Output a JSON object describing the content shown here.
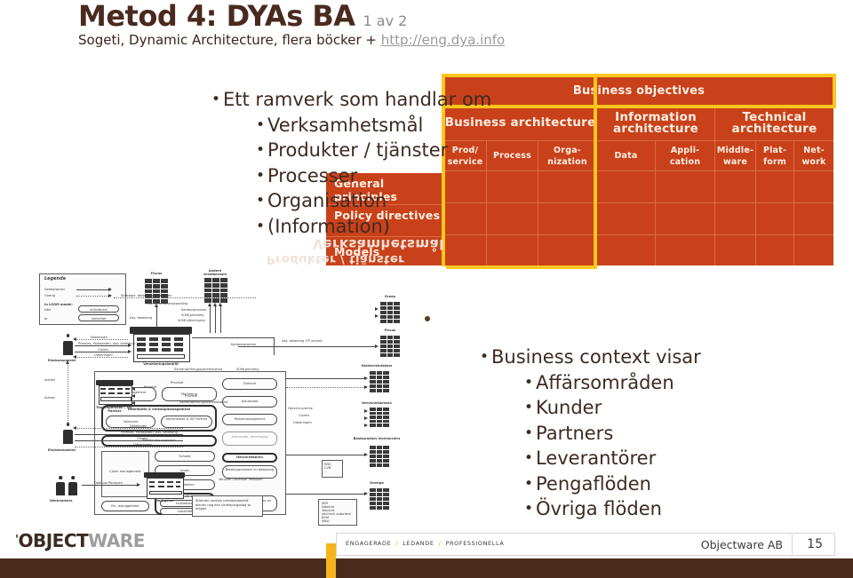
{
  "header": {
    "title_main": "Metod 4: DYAs BA",
    "title_sub": "1 av 2",
    "subtitle_prefix": "Sogeti, Dynamic Architecture, flera böcker + ",
    "subtitle_link": "http://eng.dya.info"
  },
  "bullets_top": {
    "items": [
      {
        "level": 1,
        "text": "Ett ramverk som handlar om"
      },
      {
        "level": 2,
        "text": "Verksamhetsmål"
      },
      {
        "level": 2,
        "text": "Produkter / tjänster"
      },
      {
        "level": 2,
        "text": "Processer"
      },
      {
        "level": 2,
        "text": "Organisation"
      },
      {
        "level": 2,
        "text": "(Information)"
      }
    ],
    "bullet_glyph": "•"
  },
  "bullets_bottom": {
    "items": [
      {
        "level": 1,
        "text": "Business context visar"
      },
      {
        "level": 2,
        "text": "Affärsområden"
      },
      {
        "level": 2,
        "text": "Kunder"
      },
      {
        "level": 2,
        "text": "Partners"
      },
      {
        "level": 2,
        "text": "Leverantörer"
      },
      {
        "level": 2,
        "text": "Pengaflöden"
      },
      {
        "level": 2,
        "text": "Övriga flöden"
      }
    ],
    "bullet_glyph": "•"
  },
  "dya_matrix": {
    "objectives_label": "Business objectives",
    "architectures": [
      {
        "label": "Business architecture",
        "columns": [
          "Prod/ service",
          "Process",
          "Orga- nization"
        ]
      },
      {
        "label": "Information architecture",
        "columns": [
          "Data",
          "Appli- cation"
        ]
      },
      {
        "label": "Technical architecture",
        "columns": [
          "Middle- ware",
          "Plat- form",
          "Net- work"
        ]
      }
    ],
    "row_labels": [
      "General principles",
      "Policy directives",
      "Models"
    ],
    "colors": {
      "fill": "#c9411a",
      "gridline": "#dc6a43",
      "text": "#fdf0e4",
      "highlight": "#ffc61e"
    },
    "highlights": [
      "Business objectives",
      "Business architecture"
    ]
  },
  "diagram": {
    "legend": {
      "title": "Legenda",
      "rows": [
        "Geldstromen",
        "Overig"
      ],
      "model_note": "In LSOM model:",
      "no_label": "Nee",
      "yes_label": "Ja",
      "no_value": "Individueel",
      "yes_value": "Collectief"
    },
    "actors": [
      "Fiscus",
      "Andere verzekeraars",
      "Eindconsument",
      "Tussenpersoon / SD-Partner",
      "Werknemers",
      "Werkgever",
      "Overig",
      "Geldverstrekkers",
      "Herverzekeraars",
      "Basisproduct leveranciers",
      "Overige"
    ],
    "center_title": "Verzekeringsbedrijf",
    "center_units": [
      "Directie",
      "Actuariaat",
      "Risicomanagement",
      "Informatie- beveiliging",
      "Product management",
      "Marketing",
      "Distributie & verkoopmanagement",
      "Volmacht",
      "Intermediair & SD Partner",
      "Relatie management",
      "Schade",
      "Leven",
      "Hypotheken",
      "Pensioenen",
      "Individueel",
      "Collectief",
      "Claim management",
      "Fin. management",
      "Herverzekeren",
      "Betalingsverkeer en bewaking",
      "Financiele administratie en verantwoording"
    ],
    "flow_labels": [
      "Strategie, bedrijfsdoelstellingen",
      "Financiele verantwoording",
      "Ass. belasting (TP omzet)",
      "Ass. belasting",
      "Kantoorprovisie",
      "SOM(premies)",
      "SOM(uitkeringen)",
      "Dekkingen",
      "Premies, Poliskosten, Ass. belasting",
      "Claims",
      "Uitkeringen",
      "Advies",
      "Provisie",
      "Samenwerkingsovereenkomst",
      "Opbouw Pensioen",
      "Verzuim Collectief Pensioen",
      "Herverz.premie"
    ],
    "note": "Stromen rondom pensioenbedrijf dienen nog een verdiepingsslag te krijgen."
  },
  "footer": {
    "logo_tick": "'",
    "logo_part1": "OBJECT",
    "logo_part2": "WARE",
    "tagline": [
      "ENGAGERADE",
      "LEDANDE",
      "PROFESSIONELLA"
    ],
    "tagline_slash": "/",
    "company": "Objectware AB",
    "page_number": "15"
  }
}
